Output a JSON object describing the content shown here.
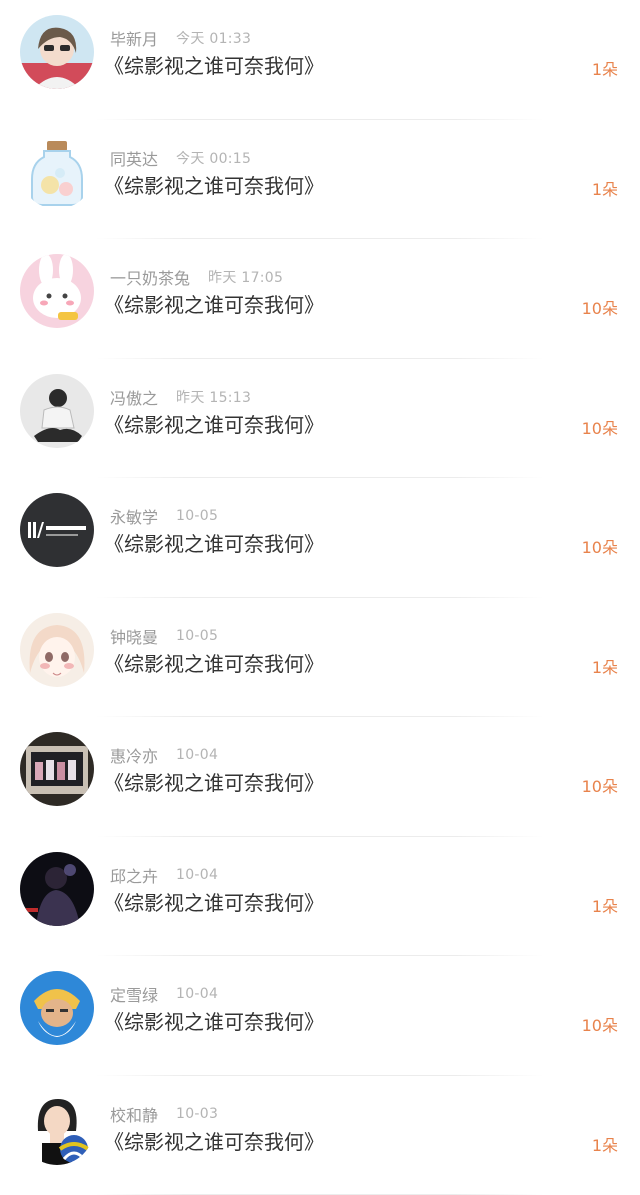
{
  "gifts": [
    {
      "user": "毕新月",
      "time": "今天 01:33",
      "title": "《综影视之谁可奈我何》",
      "amount": "1朵",
      "avatar_icon": "girl-selfie-avatar",
      "avatar_colors": [
        "#cfe6f2",
        "#6b5a4a"
      ]
    },
    {
      "user": "同英达",
      "time": "今天 00:15",
      "title": "《综影视之谁可奈我何》",
      "amount": "1朵",
      "avatar_icon": "bottle-avatar",
      "avatar_colors": [
        "#ffffff",
        "#a8d2ec"
      ]
    },
    {
      "user": "一只奶茶兔",
      "time": "昨天 17:05",
      "title": "《综影视之谁可奈我何》",
      "amount": "10朵",
      "avatar_icon": "pink-bunny-avatar",
      "avatar_colors": [
        "#f7d3df",
        "#ffffff"
      ]
    },
    {
      "user": "冯傲之",
      "time": "昨天 15:13",
      "title": "《综影视之谁可奈我何》",
      "amount": "10朵",
      "avatar_icon": "sitting-person-avatar",
      "avatar_colors": [
        "#e8e8e8",
        "#2b2b2b"
      ]
    },
    {
      "user": "永敏学",
      "time": "10-05",
      "title": "《综影视之谁可奈我何》",
      "amount": "10朵",
      "avatar_icon": "company-logo-avatar",
      "avatar_colors": [
        "#2f3033",
        "#ffffff"
      ]
    },
    {
      "user": "钟晓曼",
      "time": "10-05",
      "title": "《综影视之谁可奈我何》",
      "amount": "1朵",
      "avatar_icon": "anime-girl-avatar",
      "avatar_colors": [
        "#f6eee6",
        "#f2b7b7"
      ]
    },
    {
      "user": "惠冷亦",
      "time": "10-04",
      "title": "《综影视之谁可奈我何》",
      "amount": "10朵",
      "avatar_icon": "camera-screen-avatar",
      "avatar_colors": [
        "#2e2a25",
        "#c9c0b4"
      ]
    },
    {
      "user": "邱之卉",
      "time": "10-04",
      "title": "《综影视之谁可奈我何》",
      "amount": "1朵",
      "avatar_icon": "concert-avatar",
      "avatar_colors": [
        "#0d0d14",
        "#7a6fb0"
      ]
    },
    {
      "user": "定雪绿",
      "time": "10-04",
      "title": "《综影视之谁可奈我何》",
      "amount": "10朵",
      "avatar_icon": "warrior-avatar",
      "avatar_colors": [
        "#2e88d8",
        "#f0c24a"
      ]
    },
    {
      "user": "校和静",
      "time": "10-03",
      "title": "《综影视之谁可奈我何》",
      "amount": "1朵",
      "avatar_icon": "volleyball-kid-avatar",
      "avatar_colors": [
        "#ffffff",
        "#e2c41f"
      ]
    }
  ]
}
